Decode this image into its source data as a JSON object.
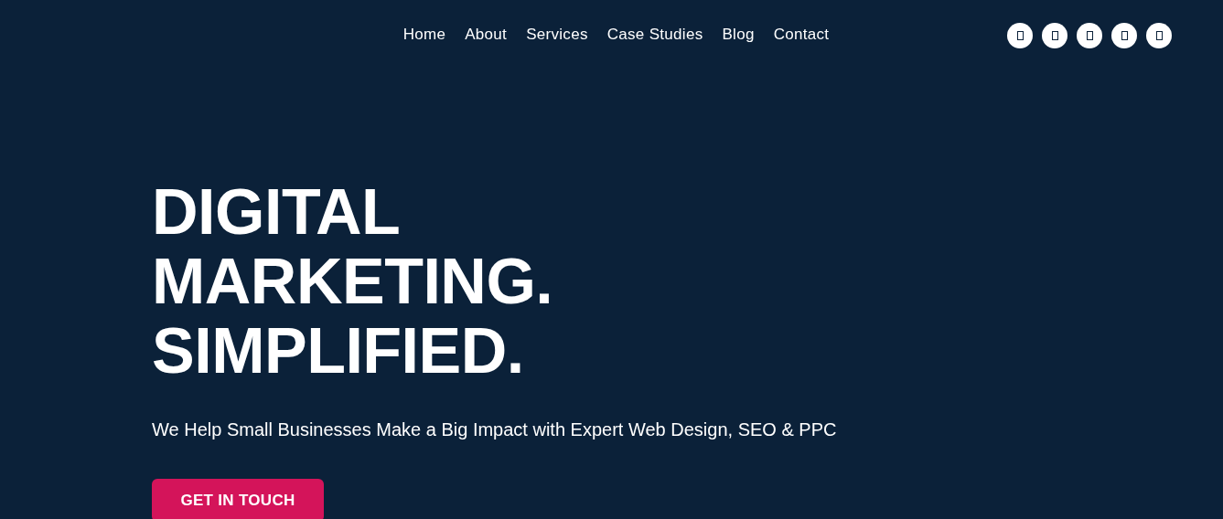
{
  "nav": {
    "items": [
      "Home",
      "About",
      "Services",
      "Case Studies",
      "Blog",
      "Contact"
    ]
  },
  "hero": {
    "heading_lines": [
      "DIGITAL",
      "MARKETING.",
      "SIMPLIFIED."
    ],
    "subtitle": "We Help Small Businesses Make a Big Impact with Expert Web Design, SEO & PPC",
    "button": "GET IN TOUCH"
  }
}
